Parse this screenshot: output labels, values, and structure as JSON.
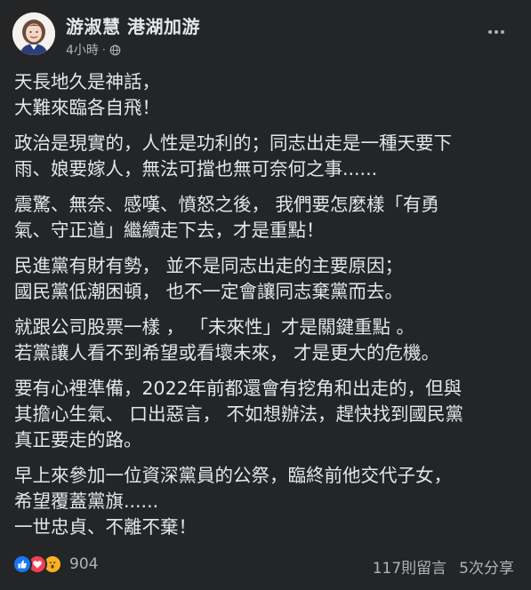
{
  "post": {
    "author": "游淑慧 港湖加游",
    "time": "4小時",
    "privacy_icon": "globe-icon",
    "paragraphs": [
      [
        "天長地久是神話，",
        "大難來臨各自飛！"
      ],
      [
        "政治是現實的，人性是功利的；同志出走是一種天要下",
        "雨、娘要嫁人，無法可擋也無可奈何之事......"
      ],
      [
        "震驚、無奈、感嘆、憤怒之後， 我們要怎麼樣「有勇",
        "氣、守正道」繼續走下去，才是重點！"
      ],
      [
        "民進黨有財有勢， 並不是同志出走的主要原因；",
        "國民黨低潮困頓， 也不一定會讓同志棄黨而去。"
      ],
      [
        "就跟公司股票一樣 ， 「未來性」才是關鍵重點 。",
        "若黨讓人看不到希望或看壞未來， 才是更大的危機。"
      ],
      [
        "要有心裡準備，2022年前都還會有挖角和出走的，但與",
        "其擔心生氣、 口出惡言， 不如想辦法，趕快找到國民黨",
        "真正要走的路。"
      ],
      [
        "早上來參加一位資深黨員的公祭，臨終前他交代子女，",
        "希望覆蓋黨旗......",
        "一世忠貞、不離不棄！"
      ]
    ]
  },
  "footer": {
    "reaction_icons": [
      "like-icon",
      "love-icon",
      "wow-icon"
    ],
    "reaction_count": "904",
    "comments": "117則留言",
    "shares": "5次分享"
  },
  "colors": {
    "background": "#242526",
    "text": "#e4e6eb",
    "secondary": "#b0b3b8",
    "like": "#1877f2",
    "love": "#f33e58",
    "wow": "#f7b125"
  }
}
